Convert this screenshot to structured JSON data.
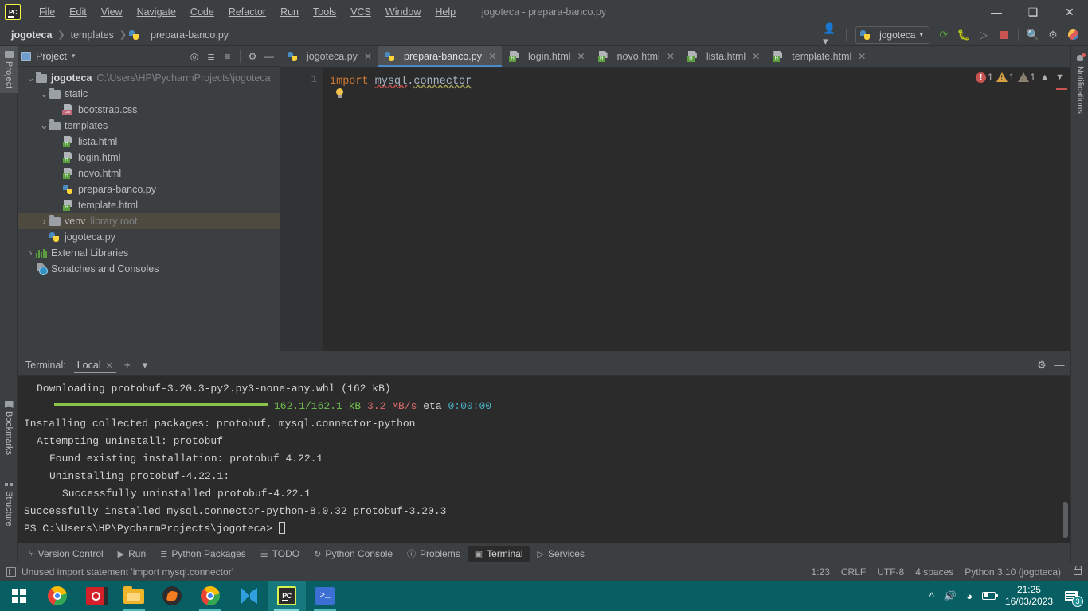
{
  "window": {
    "title": "jogoteca - prepara-banco.py",
    "app_logo": "pycharm-logo",
    "controls": {
      "minimize": "—",
      "maximize": "❐",
      "close": "✕"
    }
  },
  "menu": [
    {
      "label": "File"
    },
    {
      "label": "Edit"
    },
    {
      "label": "View"
    },
    {
      "label": "Navigate"
    },
    {
      "label": "Code"
    },
    {
      "label": "Refactor"
    },
    {
      "label": "Run"
    },
    {
      "label": "Tools"
    },
    {
      "label": "VCS"
    },
    {
      "label": "Window"
    },
    {
      "label": "Help"
    }
  ],
  "breadcrumbs": [
    {
      "label": "jogoteca",
      "icon": ""
    },
    {
      "label": "templates",
      "icon": ""
    },
    {
      "label": "prepara-banco.py",
      "icon": "python-file-icon"
    }
  ],
  "toolbar": {
    "user_icon": "user-account-icon",
    "run_config": "jogoteca",
    "run_config_icon": "python-file-icon",
    "run_icon": "run-icon",
    "debug_icon": "debug-icon",
    "coverage_icon": "run-with-coverage-icon",
    "stop_icon": "stop-icon",
    "search_icon": "search-icon",
    "settings_icon": "gear-icon",
    "ide_icon": "ide-helper-icon"
  },
  "rails": {
    "left_top": [
      {
        "label": "Project",
        "icon": "project-icon",
        "active": true
      }
    ],
    "left_bottom": [
      {
        "label": "Bookmarks",
        "icon": "bookmark-icon"
      },
      {
        "label": "Structure",
        "icon": "structure-icon"
      }
    ],
    "right": [
      {
        "label": "Notifications",
        "icon": "bell-icon"
      }
    ]
  },
  "project_panel": {
    "title": "Project",
    "actions": [
      "locate-icon",
      "expand-all-icon",
      "collapse-all-icon",
      "gear-icon",
      "minimize-icon"
    ],
    "tree": [
      {
        "label": "jogoteca",
        "sub": "C:\\Users\\HP\\PycharmProjects\\jogoteca",
        "icon": "folder",
        "indent": 0,
        "arrow": "v",
        "bold": true
      },
      {
        "label": "static",
        "sub": "",
        "icon": "folder",
        "indent": 1,
        "arrow": "v",
        "bold": false
      },
      {
        "label": "bootstrap.css",
        "sub": "",
        "icon": "css",
        "indent": 2,
        "arrow": "",
        "bold": false
      },
      {
        "label": "templates",
        "sub": "",
        "icon": "folder",
        "indent": 1,
        "arrow": "v",
        "bold": false
      },
      {
        "label": "lista.html",
        "sub": "",
        "icon": "html",
        "indent": 2,
        "arrow": "",
        "bold": false
      },
      {
        "label": "login.html",
        "sub": "",
        "icon": "html",
        "indent": 2,
        "arrow": "",
        "bold": false
      },
      {
        "label": "novo.html",
        "sub": "",
        "icon": "html",
        "indent": 2,
        "arrow": "",
        "bold": false
      },
      {
        "label": "prepara-banco.py",
        "sub": "",
        "icon": "py",
        "indent": 2,
        "arrow": "",
        "bold": false
      },
      {
        "label": "template.html",
        "sub": "",
        "icon": "html",
        "indent": 2,
        "arrow": "",
        "bold": false
      },
      {
        "label": "venv",
        "sub": "library root",
        "icon": "folder",
        "indent": 1,
        "arrow": ">",
        "bold": false,
        "selected": true
      },
      {
        "label": "jogoteca.py",
        "sub": "",
        "icon": "py",
        "indent": 1,
        "arrow": "",
        "bold": false
      },
      {
        "label": "External Libraries",
        "sub": "",
        "icon": "lib",
        "indent": 0,
        "arrow": ">",
        "bold": false
      },
      {
        "label": "Scratches and Consoles",
        "sub": "",
        "icon": "scratch",
        "indent": 0,
        "arrow": "",
        "bold": false
      }
    ]
  },
  "editor": {
    "tabs": [
      {
        "label": "jogoteca.py",
        "icon": "py",
        "active": false
      },
      {
        "label": "prepara-banco.py",
        "icon": "py",
        "active": true
      },
      {
        "label": "login.html",
        "icon": "html",
        "active": false
      },
      {
        "label": "novo.html",
        "icon": "html",
        "active": false
      },
      {
        "label": "lista.html",
        "icon": "html",
        "active": false
      },
      {
        "label": "template.html",
        "icon": "html",
        "active": false
      }
    ],
    "line_numbers": [
      "1"
    ],
    "code": {
      "keyword": "import",
      "module": "mysql",
      "dot": ".",
      "submodule": "connector"
    },
    "bulb_icon": "intention-bulb-icon",
    "inspections": {
      "errors": "1",
      "warnings": "1",
      "weak_warnings": "1",
      "error_icon": "error-icon",
      "warning_icon": "warning-icon",
      "weak_warning_icon": "weak-warning-icon",
      "prev_icon": "chevron-up-icon",
      "next_icon": "chevron-down-icon"
    }
  },
  "terminal": {
    "label": "Terminal:",
    "tabs": [
      {
        "label": "Local",
        "active": true
      }
    ],
    "add_icon": "plus-icon",
    "dropdown_icon": "chevron-down-icon",
    "settings_icon": "gear-icon",
    "minimize_icon": "minimize-icon",
    "lines": [
      {
        "indent": 1,
        "segments": [
          {
            "text": "Downloading protobuf-3.20.3-py2.py3-none-any.whl (162 kB)",
            "color": "default"
          }
        ]
      },
      {
        "indent": 0,
        "progress": true,
        "segments": [
          {
            "text": "162.1/162.1 kB ",
            "color": "green"
          },
          {
            "text": "3.2 MB/s ",
            "color": "red"
          },
          {
            "text": "eta ",
            "color": "default"
          },
          {
            "text": "0:00:00",
            "color": "cyan"
          }
        ]
      },
      {
        "indent": 0,
        "segments": [
          {
            "text": "Installing collected packages: protobuf, mysql.connector-python",
            "color": "default"
          }
        ]
      },
      {
        "indent": 1,
        "segments": [
          {
            "text": "Attempting uninstall: protobuf",
            "color": "default"
          }
        ]
      },
      {
        "indent": 2,
        "segments": [
          {
            "text": "Found existing installation: protobuf 4.22.1",
            "color": "default"
          }
        ]
      },
      {
        "indent": 2,
        "segments": [
          {
            "text": "Uninstalling protobuf-4.22.1:",
            "color": "default"
          }
        ]
      },
      {
        "indent": 3,
        "segments": [
          {
            "text": "Successfully uninstalled protobuf-4.22.1",
            "color": "default"
          }
        ]
      },
      {
        "indent": 0,
        "segments": [
          {
            "text": "Successfully installed mysql.connector-python-8.0.32 protobuf-3.20.3",
            "color": "default"
          }
        ]
      },
      {
        "indent": 0,
        "prompt": true,
        "segments": [
          {
            "text": "PS C:\\Users\\HP\\PycharmProjects\\jogoteca> ",
            "color": "default"
          }
        ]
      }
    ]
  },
  "tool_window_bar": [
    {
      "label": "Version Control",
      "icon": "branch-icon",
      "active": false
    },
    {
      "label": "Run",
      "icon": "run-icon",
      "active": false
    },
    {
      "label": "Python Packages",
      "icon": "packages-icon",
      "active": false
    },
    {
      "label": "TODO",
      "icon": "todo-list-icon",
      "active": false
    },
    {
      "label": "Python Console",
      "icon": "python-console-icon",
      "active": false
    },
    {
      "label": "Problems",
      "icon": "problems-icon",
      "active": false
    },
    {
      "label": "Terminal",
      "icon": "terminal-icon",
      "active": true
    },
    {
      "label": "Services",
      "icon": "services-icon",
      "active": false
    }
  ],
  "status_bar": {
    "message": "Unused import statement 'import mysql.connector'",
    "message_icon": "event-log-icon",
    "caret_position": "1:23",
    "line_separator": "CRLF",
    "encoding": "UTF-8",
    "indent": "4 spaces",
    "interpreter": "Python 3.10 (jogoteca)",
    "lock_icon": "unlocked-icon"
  },
  "taskbar": {
    "apps": [
      {
        "name": "start-button",
        "icon": "windows-start-icon",
        "state": ""
      },
      {
        "name": "chrome",
        "icon": "chrome-icon",
        "state": ""
      },
      {
        "name": "media-app",
        "icon": "red-disc-icon",
        "state": ""
      },
      {
        "name": "file-explorer",
        "icon": "folder-icon",
        "state": "open"
      },
      {
        "name": "fl-studio",
        "icon": "fl-studio-icon",
        "state": ""
      },
      {
        "name": "chrome-2",
        "icon": "chrome-icon",
        "state": "open"
      },
      {
        "name": "vscode",
        "icon": "vscode-icon",
        "state": ""
      },
      {
        "name": "pycharm",
        "icon": "pycharm-icon",
        "state": "active"
      },
      {
        "name": "powershell",
        "icon": "powershell-icon",
        "state": "open"
      }
    ],
    "tray": {
      "chevron": "show-hidden-icons",
      "volume": "volume-icon",
      "network": "wifi-icon",
      "battery": "battery-icon",
      "time": "21:25",
      "date": "16/03/2023",
      "notifications_count": "3"
    }
  }
}
